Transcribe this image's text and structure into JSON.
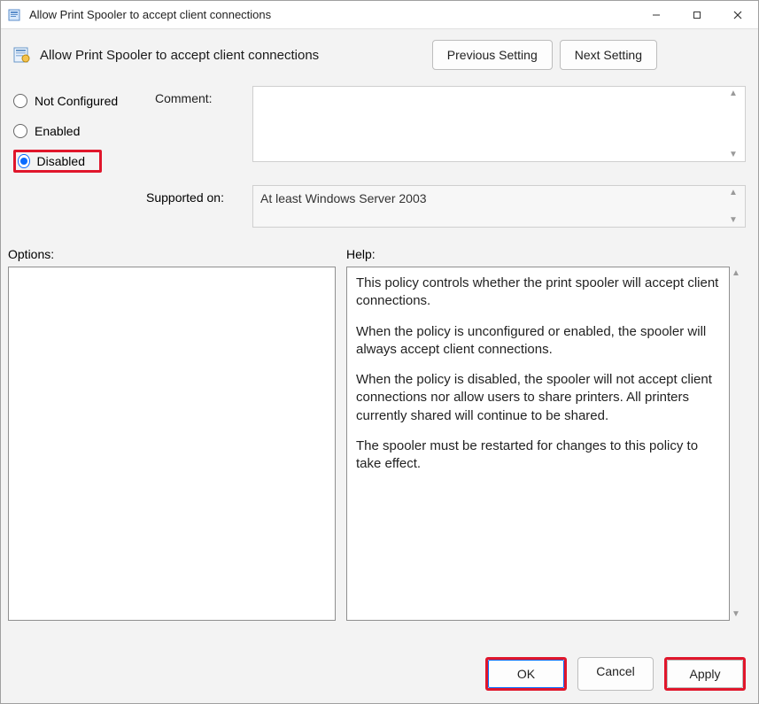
{
  "titlebar": {
    "title": "Allow Print Spooler to accept client connections"
  },
  "header": {
    "policy_title": "Allow Print Spooler to accept client connections",
    "previous": "Previous Setting",
    "next": "Next Setting"
  },
  "radios": {
    "not_configured": "Not Configured",
    "enabled": "Enabled",
    "disabled": "Disabled",
    "selected": "disabled"
  },
  "labels": {
    "comment": "Comment:",
    "supported_on": "Supported on:",
    "options": "Options:",
    "help": "Help:"
  },
  "fields": {
    "comment_value": "",
    "supported_value": "At least Windows Server 2003"
  },
  "help": {
    "p1": "This policy controls whether the print spooler will accept client connections.",
    "p2": "When the policy is unconfigured or enabled, the spooler will always accept client connections.",
    "p3": "When the policy is disabled, the spooler will not accept client connections nor allow users to share printers.  All printers currently shared will continue to be shared.",
    "p4": "The spooler must be restarted for changes to this policy to take effect."
  },
  "footer": {
    "ok": "OK",
    "cancel": "Cancel",
    "apply": "Apply"
  }
}
